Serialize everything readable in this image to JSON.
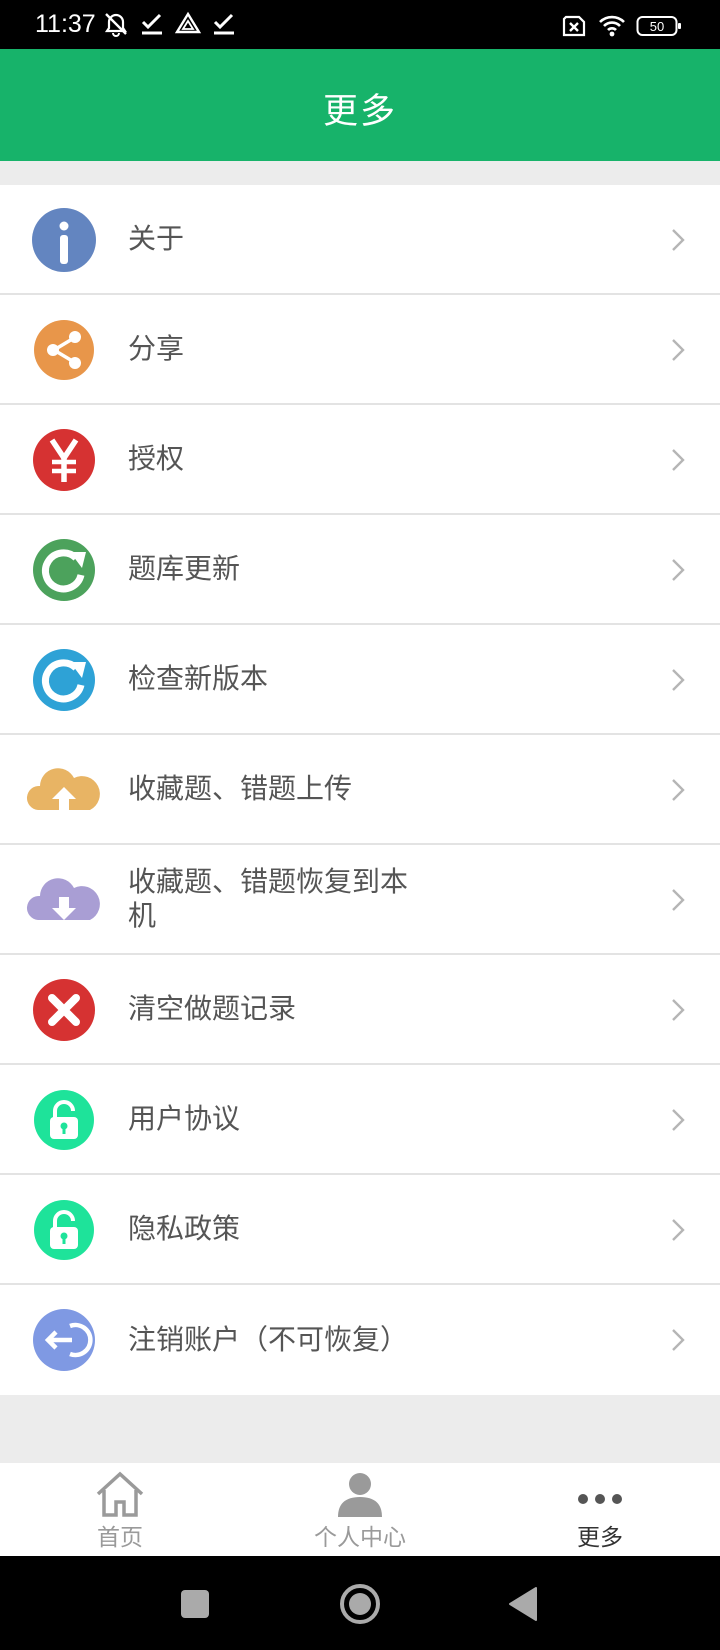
{
  "status_bar": {
    "time": "11:37",
    "battery": "50",
    "left_icons": [
      "alarm-off-icon",
      "check-icon",
      "triangle-icon",
      "check-icon"
    ],
    "right_icons": [
      "sim-x-icon",
      "wifi-icon",
      "battery-icon"
    ]
  },
  "header": {
    "title": "更多"
  },
  "menu": {
    "items": [
      {
        "label": "关于",
        "icon": "info-icon",
        "color": "#6385c0"
      },
      {
        "label": "分享",
        "icon": "share-icon",
        "color": "#e8964a"
      },
      {
        "label": "授权",
        "icon": "yen-icon",
        "color": "#d63232"
      },
      {
        "label": "题库更新",
        "icon": "refresh-green-icon",
        "color": "#4ca25c"
      },
      {
        "label": "检查新版本",
        "icon": "refresh-blue-icon",
        "color": "#2ea2d6"
      },
      {
        "label": "收藏题、错题上传",
        "icon": "cloud-upload-icon",
        "color": "#e8b464"
      },
      {
        "label": "收藏题、错题恢复到本机",
        "icon": "cloud-download-icon",
        "color": "#a99ed4"
      },
      {
        "label": "清空做题记录",
        "icon": "clear-x-icon",
        "color": "#d63232"
      },
      {
        "label": "用户协议",
        "icon": "lock-icon",
        "color": "#1ee39a"
      },
      {
        "label": "隐私政策",
        "icon": "lock-icon",
        "color": "#1ee39a"
      },
      {
        "label": "注销账户（不可恢复）",
        "icon": "logout-icon",
        "color": "#7f99e3"
      }
    ]
  },
  "bottom_nav": {
    "items": [
      {
        "label": "首页",
        "icon": "home-icon",
        "active": false
      },
      {
        "label": "个人中心",
        "icon": "person-icon",
        "active": false
      },
      {
        "label": "更多",
        "icon": "more-dots-icon",
        "active": true
      }
    ]
  },
  "colors": {
    "brand": "#17b36a",
    "background": "#ececec",
    "text": "#555555",
    "inactive": "#9a9a9a"
  }
}
